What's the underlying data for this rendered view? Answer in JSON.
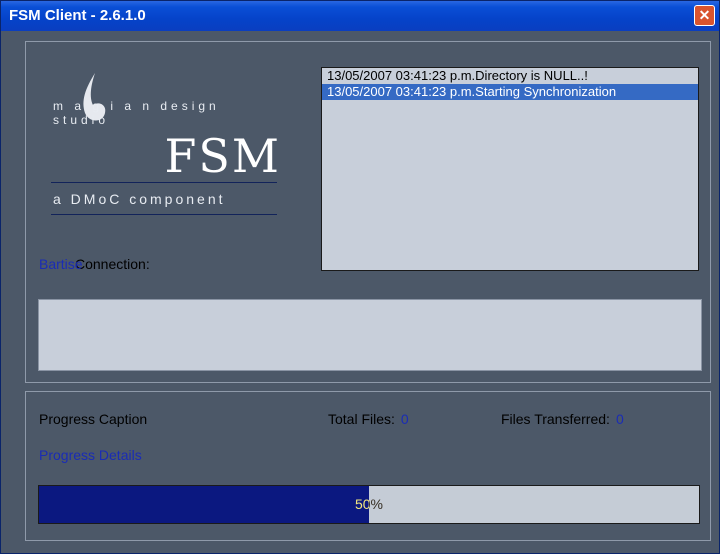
{
  "window": {
    "title": "FSM Client - 2.6.1.0",
    "close_label": "✕"
  },
  "logo": {
    "studio": "m a g i a n  design studio",
    "product": "FSM",
    "subtitle": "a DMoC component"
  },
  "log": {
    "items": [
      {
        "text": "13/05/2007 03:41:23 p.m.Directory is NULL..!",
        "selected": false
      },
      {
        "text": "13/05/2007 03:41:23 p.m.Starting Synchronization",
        "selected": true
      }
    ]
  },
  "status": {
    "label": "Connection:",
    "overlay_text": "Bartise",
    "message": ""
  },
  "progress": {
    "caption": "Progress Caption",
    "details": "Progress Details",
    "total_files_label": "Total Files:",
    "total_files_value": "0",
    "files_transferred_label": "Files Transferred:",
    "files_transferred_value": "0",
    "percent": 50,
    "percent_text": "50%"
  },
  "colors": {
    "accent": "#0b1880",
    "link": "#1a2cb5",
    "background": "#4c5868"
  }
}
